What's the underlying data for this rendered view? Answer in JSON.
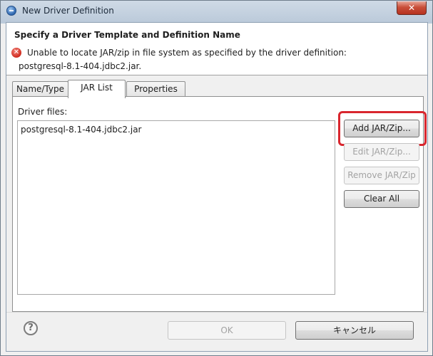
{
  "window": {
    "title": "New Driver Definition",
    "close_glyph": "✕"
  },
  "header": {
    "title": "Specify a Driver Template and Definition Name",
    "error_icon": "error-icon",
    "error_line1": "Unable to locate JAR/zip in file system as specified by the driver definition:",
    "error_line2": "postgresql-8.1-404.jdbc2.jar."
  },
  "tabs": [
    {
      "label": "Name/Type",
      "active": false
    },
    {
      "label": "JAR List",
      "active": true
    },
    {
      "label": "Properties",
      "active": false
    }
  ],
  "jar_list": {
    "label": "Driver files:",
    "files": [
      "postgresql-8.1-404.jdbc2.jar"
    ]
  },
  "buttons": {
    "add": "Add JAR/Zip...",
    "edit": "Edit JAR/Zip...",
    "remove": "Remove JAR/Zip",
    "clear": "Clear All"
  },
  "footer": {
    "help_glyph": "?",
    "ok": "OK",
    "cancel": "キャンセル"
  },
  "colors": {
    "highlight": "#d9262e",
    "error": "#cc2418"
  }
}
